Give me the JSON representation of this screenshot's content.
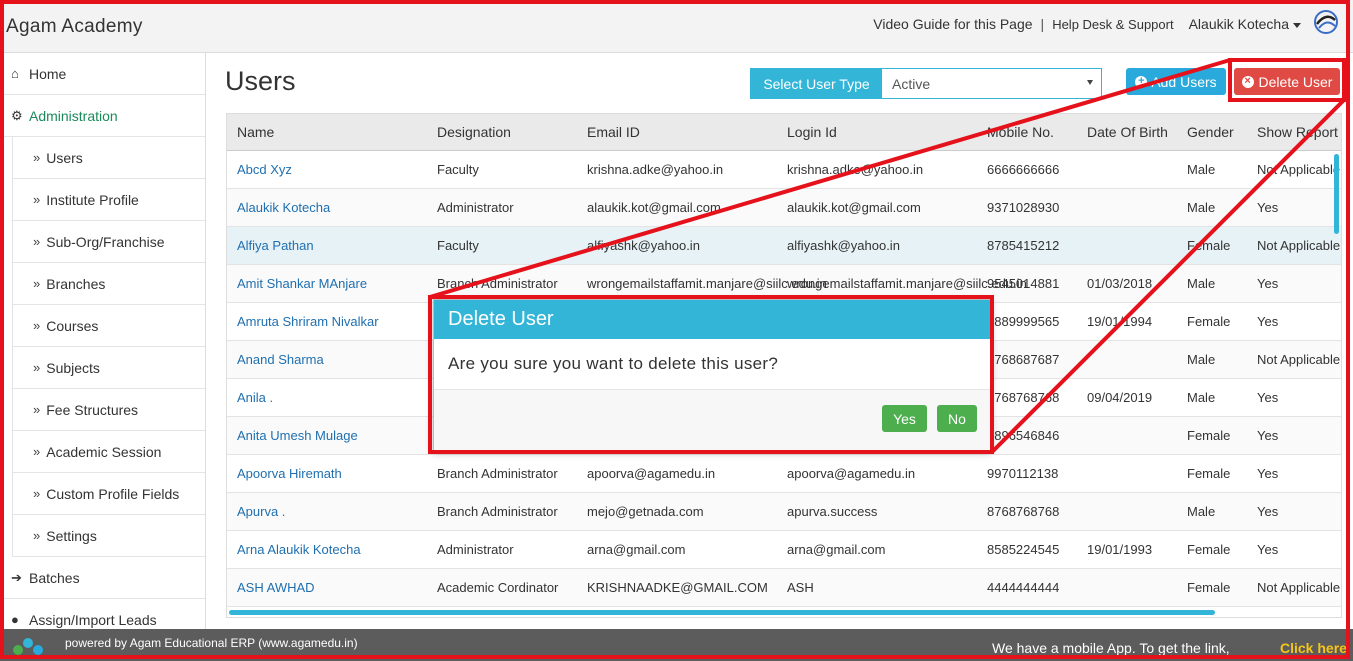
{
  "app": {
    "brand": "Agam Academy"
  },
  "topbar": {
    "video_guide": "Video Guide for this Page",
    "separator": "|",
    "help": "Help Desk & Support",
    "user": "Alaukik Kotecha"
  },
  "sidebar": {
    "home": "Home",
    "administration": "Administration",
    "sub_items": [
      "Users",
      "Institute Profile",
      "Sub-Org/Franchise",
      "Branches",
      "Courses",
      "Subjects",
      "Fee Structures",
      "Academic Session",
      "Custom Profile Fields",
      "Settings"
    ],
    "batches": "Batches",
    "assign_leads": "Assign/Import Leads"
  },
  "main": {
    "title": "Users",
    "user_type_label": "Select User Type",
    "user_type_value": "Active",
    "add_users": "Add Users",
    "delete_user": "Delete User"
  },
  "table": {
    "headers": [
      "Name",
      "Designation",
      "Email ID",
      "Login Id",
      "Mobile No.",
      "Date Of Birth",
      "Gender",
      "Show Report"
    ],
    "rows": [
      [
        "Abcd Xyz",
        "Faculty",
        "krishna.adke@yahoo.in",
        "krishna.adke@yahoo.in",
        "6666666666",
        "",
        "Male",
        "Not Applicable"
      ],
      [
        "Alaukik Kotecha",
        "Administrator",
        "alaukik.kot@gmail.com",
        "alaukik.kot@gmail.com",
        "9371028930",
        "",
        "Male",
        "Yes"
      ],
      [
        "Alfiya Pathan",
        "Faculty",
        "alfiyashk@yahoo.in",
        "alfiyashk@yahoo.in",
        "8785415212",
        "",
        "Female",
        "Not Applicable"
      ],
      [
        "Amit Shankar MAnjare",
        "Branch Administrator",
        "wrongemailstaffamit.manjare@siilc.edu.in",
        "wrongemailstaffamit.manjare@siilc.edu.in",
        "9545014881",
        "01/03/2018",
        "Male",
        "Yes"
      ],
      [
        "Amruta Shriram Nivalkar",
        "",
        "",
        "",
        "8889999565",
        "19/01/1994",
        "Female",
        "Yes"
      ],
      [
        "Anand Sharma",
        "",
        "",
        "",
        "8768687687",
        "",
        "Male",
        "Not Applicable"
      ],
      [
        "Anila .",
        "",
        "",
        "",
        "8768768768",
        "09/04/2019",
        "Male",
        "Yes"
      ],
      [
        "Anita Umesh Mulage",
        "",
        "",
        "",
        "8896546846",
        "",
        "Female",
        "Yes"
      ],
      [
        "Apoorva Hiremath",
        "Branch Administrator",
        "apoorva@agamedu.in",
        "apoorva@agamedu.in",
        "9970112138",
        "",
        "Female",
        "Yes"
      ],
      [
        "Apurva .",
        "Branch Administrator",
        "mejo@getnada.com",
        "apurva.success",
        "8768768768",
        "",
        "Male",
        "Yes"
      ],
      [
        "Arna Alaukik Kotecha",
        "Administrator",
        "arna@gmail.com",
        "arna@gmail.com",
        "8585224545",
        "19/01/1993",
        "Female",
        "Yes"
      ],
      [
        "ASH AWHAD",
        "Academic Cordinator",
        "KRISHNAADKE@GMAIL.COM",
        "ASH",
        "4444444444",
        "",
        "Female",
        "Not Applicable"
      ]
    ]
  },
  "modal": {
    "title": "Delete User",
    "message": "Are you sure you want to delete this user?",
    "yes": "Yes",
    "no": "No"
  },
  "footer": {
    "powered": "powered by Agam Educational ERP (www.agamedu.in)",
    "mobile": "We have a mobile App. To get the link,",
    "click": "Click here."
  },
  "colors": {
    "accent": "#33b5d8",
    "danger": "#e04a44",
    "success": "#4cae4c",
    "annotation": "#e5121c",
    "link": "#1f6fb0",
    "active_menu": "#1b8a5a"
  }
}
